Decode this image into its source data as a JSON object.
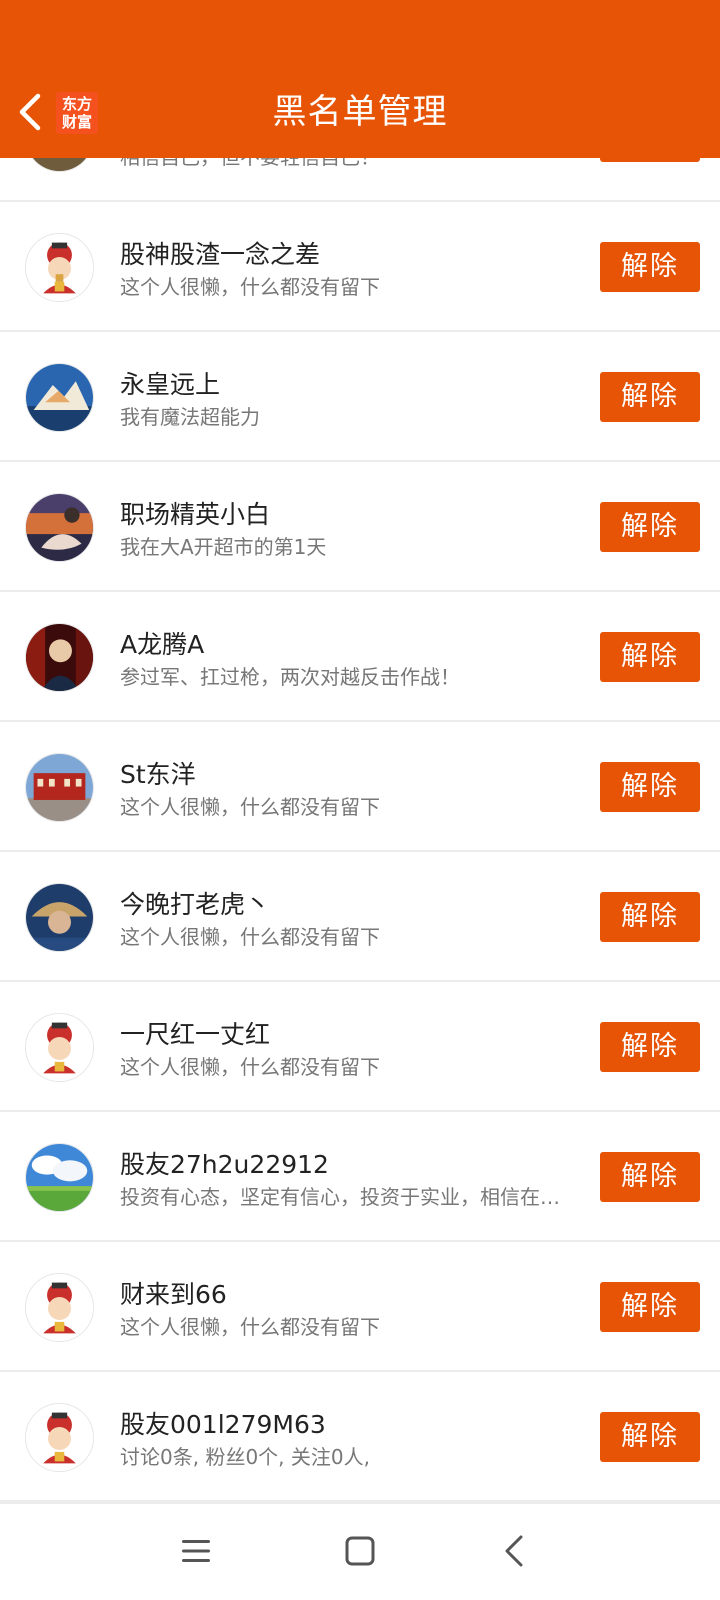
{
  "header": {
    "title": "黑名单管理",
    "logo_line1": "东方",
    "logo_line2": "财富",
    "back_icon": "chevron-left-icon"
  },
  "colors": {
    "accent": "#E85406",
    "text_primary": "#222222",
    "text_secondary": "#777777",
    "divider": "#ECECEC"
  },
  "button_label": "解除",
  "rows": [
    {
      "name": "",
      "bio": "相信自己，但不要轻信自己！",
      "avatar": "landscape-avatar"
    },
    {
      "name": "股神股渣一念之差",
      "bio": "这个人很懒，什么都没有留下",
      "avatar": "caishen-default-avatar"
    },
    {
      "name": "永皇远上",
      "bio": "我有魔法超能力",
      "avatar": "mountain-avatar"
    },
    {
      "name": "职场精英小白",
      "bio": "我在大A开超市的第1天",
      "avatar": "sunset-avatar"
    },
    {
      "name": "A龙腾A",
      "bio": "参过军、扛过枪，两次对越反击作战！",
      "avatar": "portrait-avatar"
    },
    {
      "name": "St东洋",
      "bio": "这个人很懒，什么都没有留下",
      "avatar": "building-avatar"
    },
    {
      "name": "今晚打老虎丶",
      "bio": "这个人很懒，什么都没有留下",
      "avatar": "hat-person-avatar"
    },
    {
      "name": "一尺红一丈红",
      "bio": "这个人很懒，什么都没有留下",
      "avatar": "caishen-default-avatar"
    },
    {
      "name": "股友27h2u22912",
      "bio": "投资有心态，坚定有信心，投资于实业，相信在…",
      "avatar": "sky-grass-avatar"
    },
    {
      "name": "财来到66",
      "bio": "这个人很懒，什么都没有留下",
      "avatar": "caishen-default-avatar"
    },
    {
      "name": "股友001l279M63",
      "bio": "讨论0条, 粉丝0个, 关注0人,",
      "avatar": "caishen-default-avatar"
    }
  ],
  "navbar": {
    "menu_icon": "menu-icon",
    "home_icon": "home-square-icon",
    "back_icon": "back-triangle-icon"
  }
}
